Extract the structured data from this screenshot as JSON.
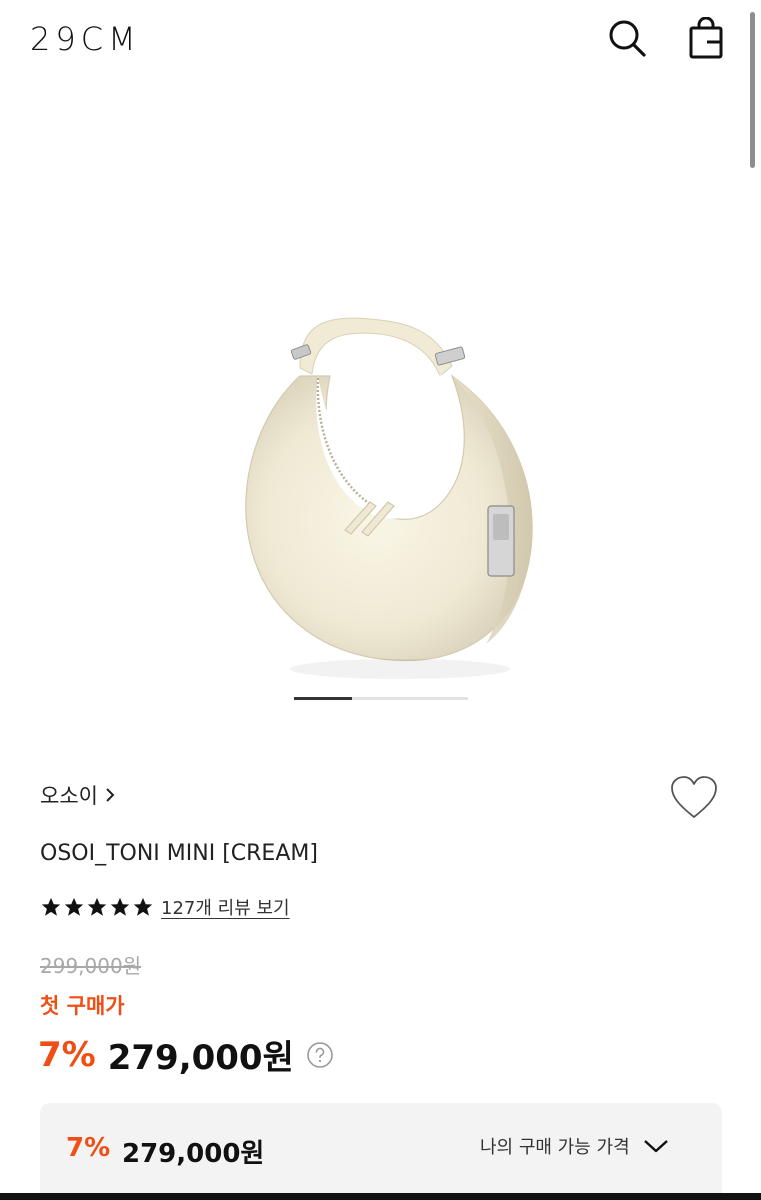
{
  "header": {
    "logo": "29CM",
    "search_icon": "search-icon",
    "bag_icon": "shopping-bag-icon"
  },
  "gallery": {
    "image": "cream crescent hobo handbag product photo",
    "page_count": 3,
    "current_page": 1
  },
  "product": {
    "brand": "오소이",
    "brand_icon": "chevron-right-icon",
    "wishlist_icon": "heart-outline-icon",
    "name": "OSOI_TONI MINI [CREAM]",
    "rating_stars": 5,
    "review_link": "127개 리뷰 보기",
    "original_price": "299,000원",
    "first_purchase_label": "첫 구매가",
    "discount": "7%",
    "price": "279,000원",
    "info_icon": "question-circle-icon"
  },
  "bottom_box": {
    "discount": "7%",
    "price": "279,000원",
    "toggle_label": "나의 구매 가능 가격",
    "toggle_icon": "chevron-down-icon"
  },
  "colors": {
    "accent": "#f04e14",
    "text": "#111111",
    "muted": "#a8a8a8",
    "panel": "#f3f3f3"
  }
}
